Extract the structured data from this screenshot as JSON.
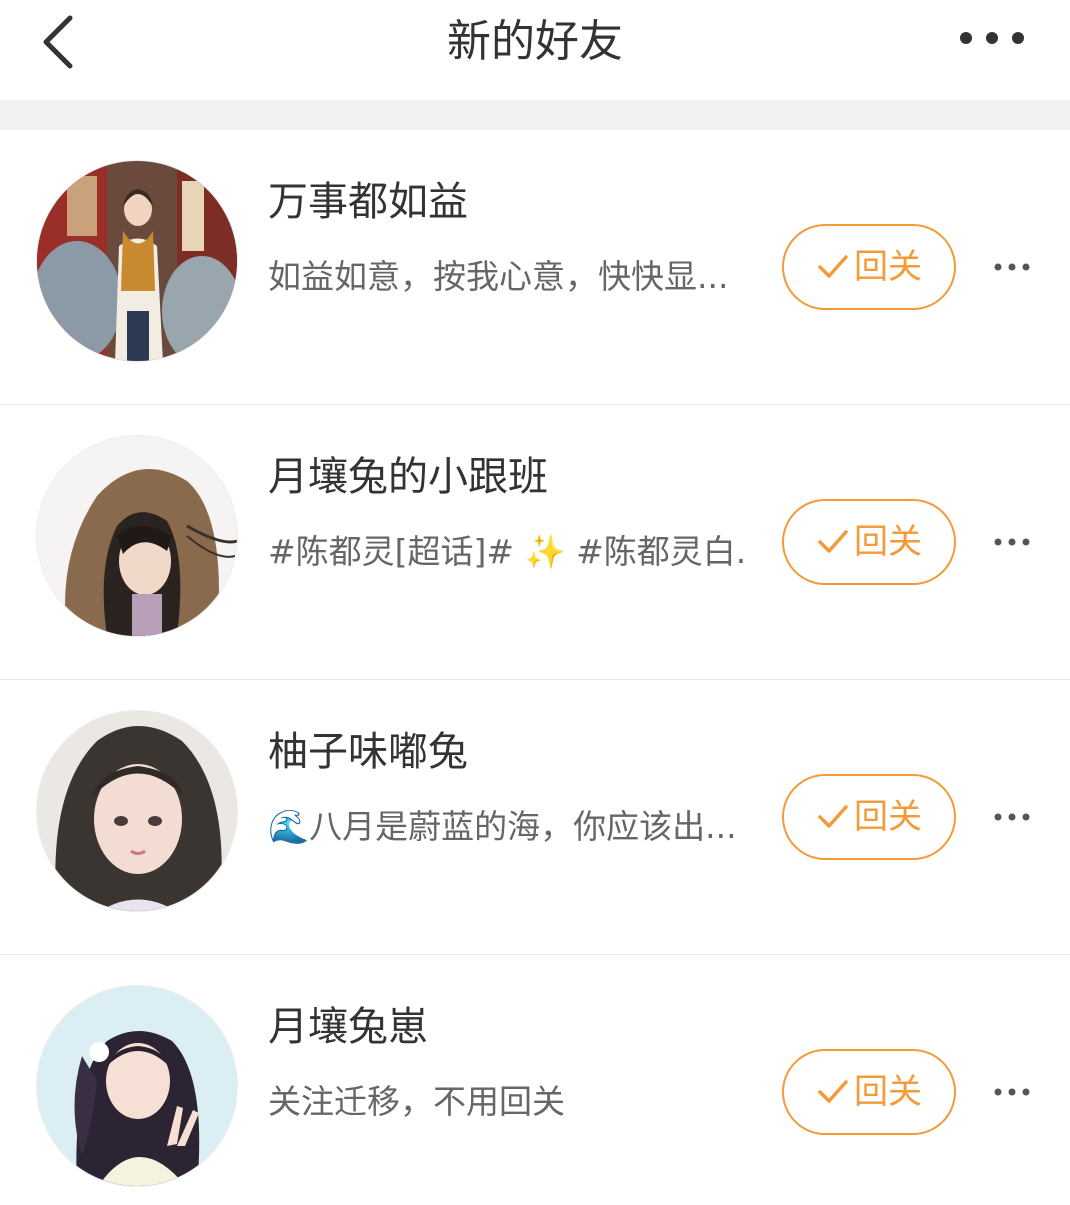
{
  "header": {
    "title": "新的好友",
    "back_icon": "chevron-left-icon",
    "more_icon": "more-horizontal-icon"
  },
  "colors": {
    "accent": "#f29b38",
    "text_primary": "#333333",
    "text_secondary": "#666666",
    "separator": "#f2f2f2"
  },
  "friends": [
    {
      "name": "万事都如益",
      "bio": "如益如意，按我心意，快快显...",
      "button_label": "回关",
      "button_icon": "check-icon"
    },
    {
      "name": "月壤兔的小跟班",
      "bio": "#陈都灵[超话]# ✨ #陈都灵白...",
      "button_label": "回关",
      "button_icon": "check-icon"
    },
    {
      "name": "柚子味嘟兔",
      "bio": "🌊八月是蔚蓝的海，你应该出...",
      "button_label": "回关",
      "button_icon": "check-icon"
    },
    {
      "name": "月壤兔崽",
      "bio": "关注迁移，不用回关",
      "button_label": "回关",
      "button_icon": "check-icon"
    }
  ]
}
